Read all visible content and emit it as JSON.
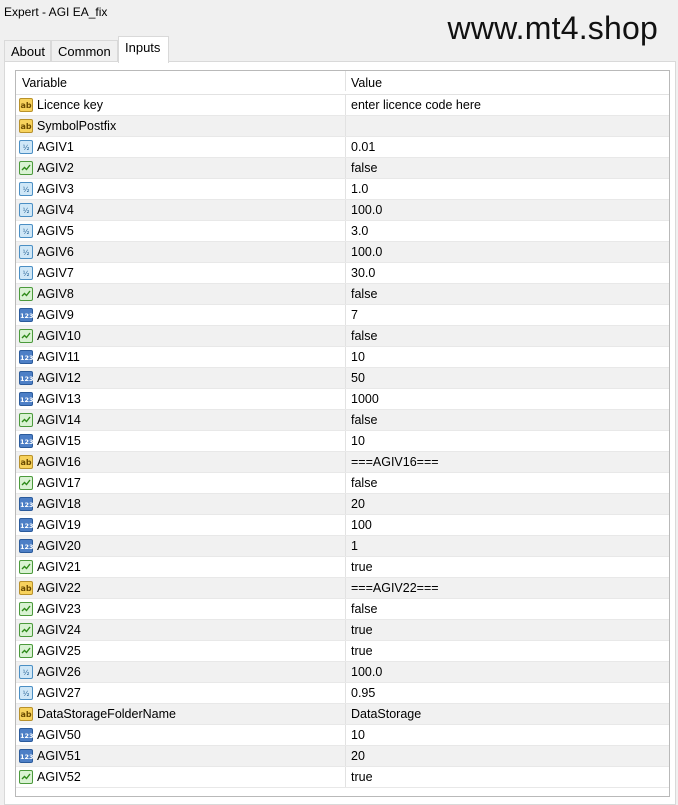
{
  "window": {
    "title": "Expert - AGI EA_fix"
  },
  "watermark": "www.mt4.shop",
  "tabs": [
    {
      "label": "About",
      "active": false
    },
    {
      "label": "Common",
      "active": false
    },
    {
      "label": "Inputs",
      "active": true
    }
  ],
  "table": {
    "headers": {
      "variable": "Variable",
      "value": "Value"
    },
    "rows": [
      {
        "name": "Licence key",
        "value": "enter licence code here",
        "type": "string"
      },
      {
        "name": "SymbolPostfix",
        "value": "",
        "type": "string"
      },
      {
        "name": "AGIV1",
        "value": "0.01",
        "type": "double"
      },
      {
        "name": "AGIV2",
        "value": "false",
        "type": "bool"
      },
      {
        "name": "AGIV3",
        "value": "1.0",
        "type": "double"
      },
      {
        "name": "AGIV4",
        "value": "100.0",
        "type": "double"
      },
      {
        "name": "AGIV5",
        "value": "3.0",
        "type": "double"
      },
      {
        "name": "AGIV6",
        "value": "100.0",
        "type": "double"
      },
      {
        "name": "AGIV7",
        "value": "30.0",
        "type": "double"
      },
      {
        "name": "AGIV8",
        "value": "false",
        "type": "bool"
      },
      {
        "name": "AGIV9",
        "value": "7",
        "type": "int"
      },
      {
        "name": "AGIV10",
        "value": "false",
        "type": "bool"
      },
      {
        "name": "AGIV11",
        "value": "10",
        "type": "int"
      },
      {
        "name": "AGIV12",
        "value": "50",
        "type": "int"
      },
      {
        "name": "AGIV13",
        "value": "1000",
        "type": "int"
      },
      {
        "name": "AGIV14",
        "value": "false",
        "type": "bool"
      },
      {
        "name": "AGIV15",
        "value": "10",
        "type": "int"
      },
      {
        "name": "AGIV16",
        "value": "===AGIV16===",
        "type": "string"
      },
      {
        "name": "AGIV17",
        "value": "false",
        "type": "bool"
      },
      {
        "name": "AGIV18",
        "value": "20",
        "type": "int"
      },
      {
        "name": "AGIV19",
        "value": "100",
        "type": "int"
      },
      {
        "name": "AGIV20",
        "value": "1",
        "type": "int"
      },
      {
        "name": "AGIV21",
        "value": "true",
        "type": "bool"
      },
      {
        "name": "AGIV22",
        "value": "===AGIV22===",
        "type": "string"
      },
      {
        "name": "AGIV23",
        "value": "false",
        "type": "bool"
      },
      {
        "name": "AGIV24",
        "value": "true",
        "type": "bool"
      },
      {
        "name": "AGIV25",
        "value": "true",
        "type": "bool"
      },
      {
        "name": "AGIV26",
        "value": "100.0",
        "type": "double"
      },
      {
        "name": "AGIV27",
        "value": "0.95",
        "type": "double"
      },
      {
        "name": "DataStorageFolderName",
        "value": "DataStorage",
        "type": "string"
      },
      {
        "name": "AGIV50",
        "value": "10",
        "type": "int"
      },
      {
        "name": "AGIV51",
        "value": "20",
        "type": "int"
      },
      {
        "name": "AGIV52",
        "value": "true",
        "type": "bool"
      }
    ]
  },
  "icons": {
    "string": {
      "name": "string-type-icon",
      "glyph": "ab"
    },
    "double": {
      "name": "double-type-icon",
      "glyph": "½"
    },
    "bool": {
      "name": "bool-type-icon",
      "glyph": ""
    },
    "int": {
      "name": "integer-type-icon",
      "glyph": "123"
    }
  }
}
